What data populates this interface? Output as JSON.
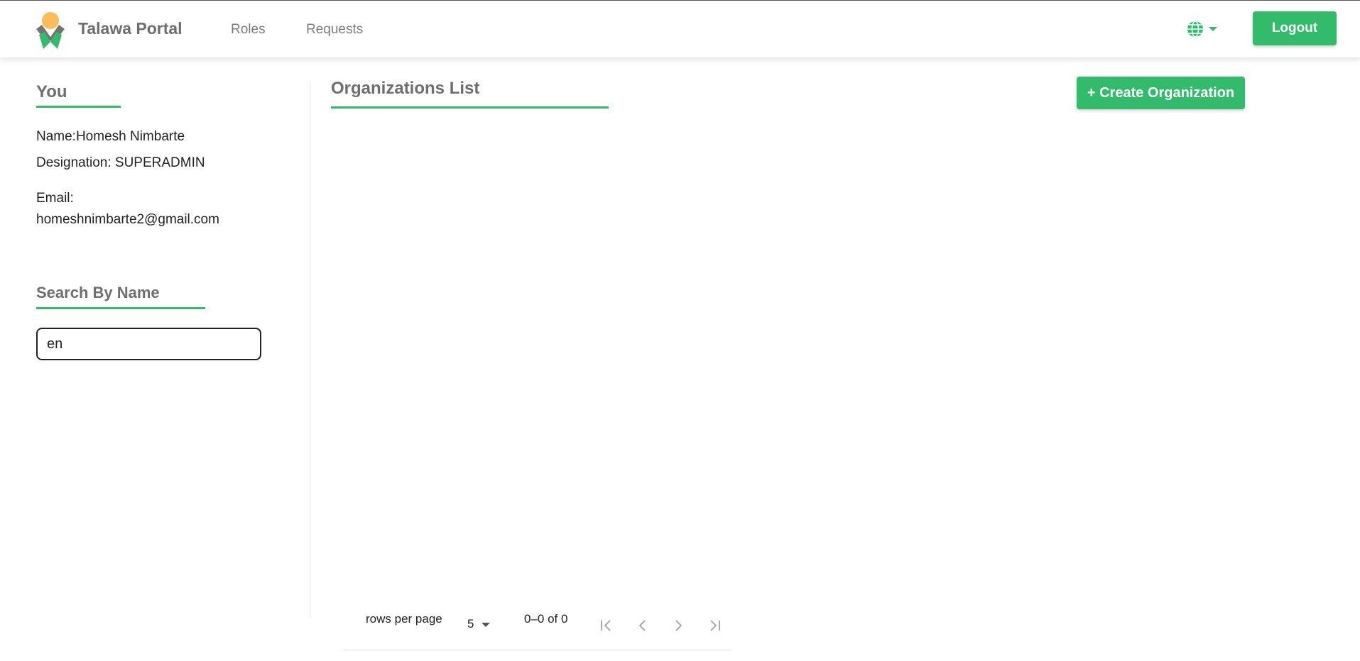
{
  "navbar": {
    "brand": "Talawa Portal",
    "links": [
      {
        "label": "Roles"
      },
      {
        "label": "Requests"
      }
    ],
    "language_icon": "globe-icon",
    "logout_label": "Logout"
  },
  "profile": {
    "title": "You",
    "name_line": "Name:Homesh Nimbarte",
    "designation_line": "Designation: SUPERADMIN",
    "email_label": "Email:",
    "email_value": "homeshnimbarte2@gmail.com"
  },
  "search": {
    "title": "Search By Name",
    "value": "en",
    "placeholder": ""
  },
  "main": {
    "title": "Organizations List",
    "create_label": "+ Create Organization"
  },
  "pagination": {
    "rows_label": "rows per page",
    "rows_value": "5",
    "range_text": "0–0 of 0"
  },
  "colors": {
    "accent": "#31bb6b",
    "heading": "#6e6e6e"
  }
}
